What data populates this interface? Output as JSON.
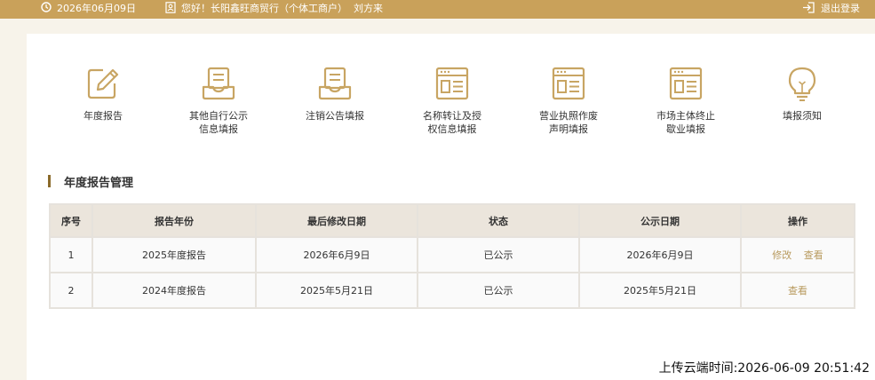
{
  "header": {
    "date": "2026年06月09日",
    "greeting": "您好！长阳鑫旺商贸行（个体工商户）  刘方来",
    "logout_label": "退出登录"
  },
  "menu": [
    {
      "label": "年度报告",
      "icon": "edit-icon"
    },
    {
      "label": "其他自行公示\n信息填报",
      "icon": "document-tray-icon"
    },
    {
      "label": "注销公告填报",
      "icon": "document-tray-icon"
    },
    {
      "label": "名称转让及授\n权信息填报",
      "icon": "browser-form-icon"
    },
    {
      "label": "营业执照作废\n声明填报",
      "icon": "browser-form-icon"
    },
    {
      "label": "市场主体终止\n歇业填报",
      "icon": "browser-form-icon"
    },
    {
      "label": "填报须知",
      "icon": "lightbulb-icon"
    }
  ],
  "section": {
    "title": "年度报告管理"
  },
  "table": {
    "headers": [
      "序号",
      "报告年份",
      "最后修改日期",
      "状态",
      "公示日期",
      "操作"
    ],
    "rows": [
      {
        "index": "1",
        "year": "2025年度报告",
        "modified": "2026年6月9日",
        "status": "已公示",
        "published": "2026年6月9日",
        "actions": [
          "修改",
          "查看"
        ]
      },
      {
        "index": "2",
        "year": "2024年度报告",
        "modified": "2025年5月21日",
        "status": "已公示",
        "published": "2025年5月21日",
        "actions": [
          "查看"
        ]
      }
    ]
  },
  "footer": {
    "upload_time": "上传云端时间:2026-06-09 20:51:42"
  },
  "colors": {
    "accent": "#c9a15a",
    "icon": "#c8a563",
    "action_link": "#b89a5e"
  }
}
